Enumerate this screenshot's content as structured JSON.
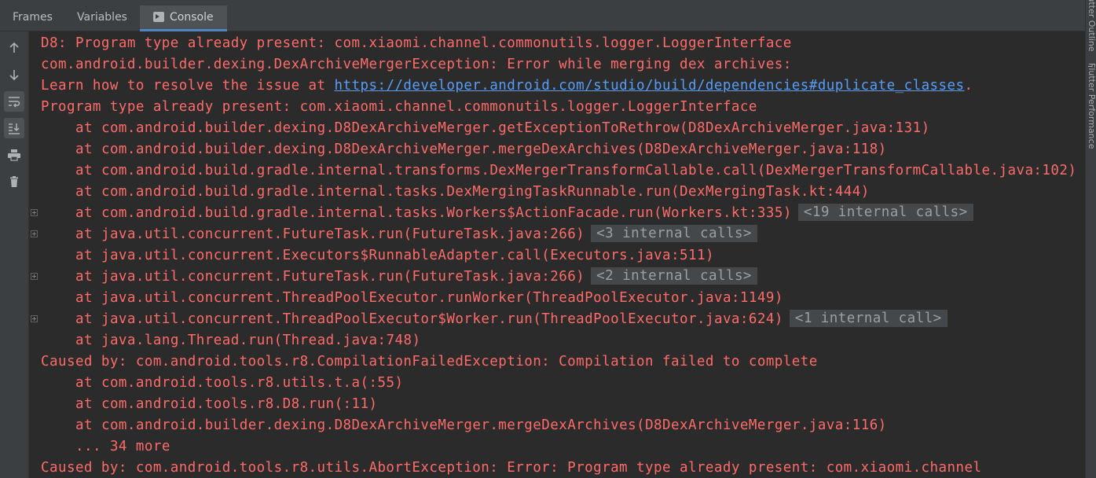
{
  "tabs": {
    "frames": "Frames",
    "variables": "Variables",
    "console": "Console"
  },
  "toolbar": [
    {
      "icon": "up-arrow-icon"
    },
    {
      "icon": "down-arrow-icon"
    },
    {
      "icon": "soft-wrap-icon"
    },
    {
      "icon": "scroll-to-end-icon",
      "active": true
    },
    {
      "icon": "print-icon"
    },
    {
      "icon": "trash-icon"
    }
  ],
  "right_strip": {
    "top_label": "Flutter Outline",
    "flutter_label": "Flutter Performance"
  },
  "console": {
    "lines": [
      {
        "text": "D8: Program type already present: com.xiaomi.channel.commonutils.logger.LoggerInterface"
      },
      {
        "text": "com.android.builder.dexing.DexArchiveMergerException: Error while merging dex archives:"
      },
      {
        "text": "Learn how to resolve the issue at ",
        "link": "https://developer.android.com/studio/build/dependencies#duplicate_classes",
        "after": "."
      },
      {
        "text": "Program type already present: com.xiaomi.channel.commonutils.logger.LoggerInterface"
      },
      {
        "text": "at com.android.builder.dexing.D8DexArchiveMerger.getExceptionToRethrow(D8DexArchiveMerger.java:131)",
        "indent": true
      },
      {
        "text": "at com.android.builder.dexing.D8DexArchiveMerger.mergeDexArchives(D8DexArchiveMerger.java:118)",
        "indent": true
      },
      {
        "text": "at com.android.build.gradle.internal.transforms.DexMergerTransformCallable.call(DexMergerTransformCallable.java:102)",
        "indent": true
      },
      {
        "text": "at com.android.build.gradle.internal.tasks.DexMergingTaskRunnable.run(DexMergingTask.kt:444)",
        "indent": true
      },
      {
        "text": "at com.android.build.gradle.internal.tasks.Workers$ActionFacade.run(Workers.kt:335)",
        "indent": true,
        "fold": "<19 internal calls>"
      },
      {
        "text": "at java.util.concurrent.FutureTask.run(FutureTask.java:266)",
        "indent": true,
        "fold": "<3 internal calls>"
      },
      {
        "text": "at java.util.concurrent.Executors$RunnableAdapter.call(Executors.java:511)",
        "indent": true
      },
      {
        "text": "at java.util.concurrent.FutureTask.run(FutureTask.java:266)",
        "indent": true,
        "fold": "<2 internal calls>"
      },
      {
        "text": "at java.util.concurrent.ThreadPoolExecutor.runWorker(ThreadPoolExecutor.java:1149)",
        "indent": true
      },
      {
        "text": "at java.util.concurrent.ThreadPoolExecutor$Worker.run(ThreadPoolExecutor.java:624)",
        "indent": true,
        "fold": "<1 internal call>"
      },
      {
        "text": "at java.lang.Thread.run(Thread.java:748)",
        "indent": true
      },
      {
        "text": "Caused by: com.android.tools.r8.CompilationFailedException: Compilation failed to complete"
      },
      {
        "text": "at com.android.tools.r8.utils.t.a(:55)",
        "indent": true
      },
      {
        "text": "at com.android.tools.r8.D8.run(:11)",
        "indent": true
      },
      {
        "text": "at com.android.builder.dexing.D8DexArchiveMerger.mergeDexArchives(D8DexArchiveMerger.java:116)",
        "indent": true
      },
      {
        "text": "... 34 more",
        "indent": true
      },
      {
        "text": "Caused by: com.android.tools.r8.utils.AbortException: Error: Program type already present: com.xiaomi.channel"
      }
    ]
  },
  "colors": {
    "error_text": "#ff6b68",
    "link": "#589df6",
    "background": "#2b2b2b",
    "panel": "#3c3f41",
    "tab_underline": "#4a88c7"
  }
}
